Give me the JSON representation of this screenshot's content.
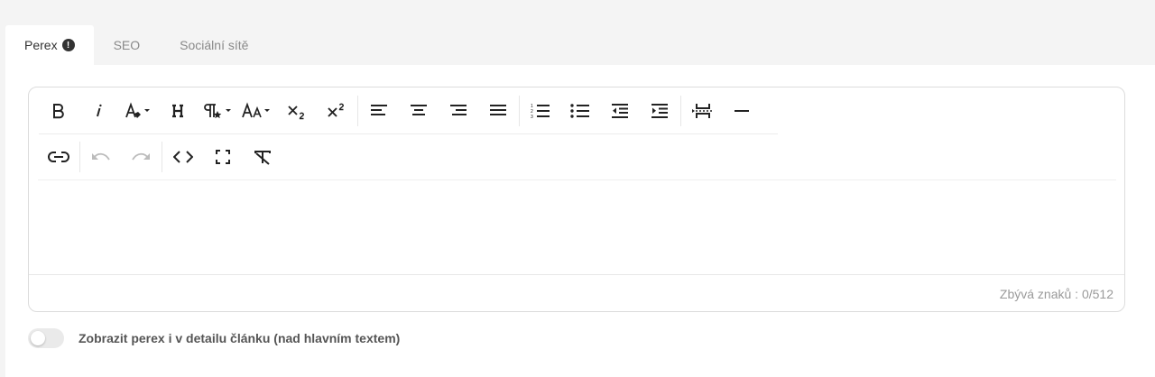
{
  "tabs": {
    "perex": "Perex",
    "perex_warning": "!",
    "seo": "SEO",
    "social": "Sociální sítě"
  },
  "toolbar": {
    "row1": [
      "bold-icon",
      "italic-icon",
      "text-color-icon",
      "heading-icon",
      "paragraph-format-icon",
      "font-size-icon",
      "subscript-icon",
      "superscript-icon",
      "align-left-icon",
      "align-center-icon",
      "align-right-icon",
      "align-justify-icon",
      "ordered-list-icon",
      "unordered-list-icon",
      "outdent-icon",
      "indent-icon",
      "page-break-icon",
      "horizontal-line-icon"
    ],
    "row2": [
      "link-icon",
      "undo-icon",
      "redo-icon",
      "code-view-icon",
      "fullscreen-icon",
      "clear-formatting-icon"
    ]
  },
  "editor": {
    "counter": "Zbývá znaků : 0/512"
  },
  "toggle": {
    "label": "Zobrazit perex i v detailu článku (nad hlavním textem)",
    "checked": false
  }
}
